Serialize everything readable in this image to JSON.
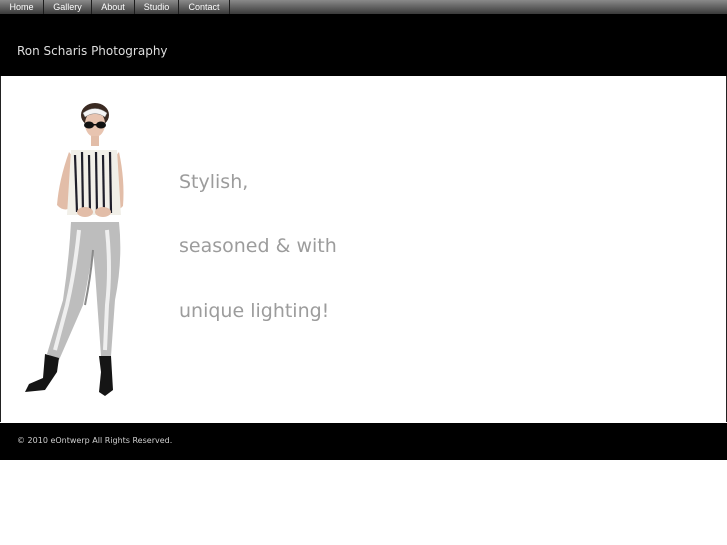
{
  "nav": {
    "items": [
      {
        "label": "Home"
      },
      {
        "label": "Gallery"
      },
      {
        "label": "About"
      },
      {
        "label": "Studio"
      },
      {
        "label": "Contact"
      }
    ]
  },
  "header": {
    "site_title": "Ron Scharis Photography"
  },
  "hero": {
    "lines": [
      "Stylish,",
      "seasoned & with",
      "unique lighting!"
    ]
  },
  "footer": {
    "copyright": "© 2010 eOntwerp All Rights Reserved."
  },
  "colors": {
    "header_bg": "#000000",
    "tagline_text": "#9c9c9c",
    "nav_text": "#ffffff"
  }
}
